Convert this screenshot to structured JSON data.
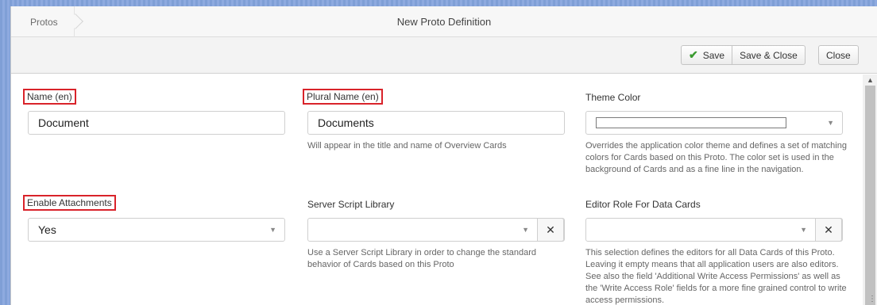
{
  "breadcrumb": {
    "item": "Protos"
  },
  "window": {
    "title": "New Proto Definition"
  },
  "toolbar": {
    "save_label": "Save",
    "save_close_label": "Save & Close",
    "close_label": "Close"
  },
  "icons": {
    "save": "check-icon",
    "dropdown": "caret-down-icon",
    "clear": "times-icon",
    "scroll_up": "caret-up-icon"
  },
  "colors": {
    "save_check": "#3a9a2f",
    "highlight": "#d9232a"
  },
  "fields": {
    "name": {
      "label": "Name (en)",
      "value": "Document"
    },
    "plural_name": {
      "label": "Plural Name (en)",
      "value": "Documents",
      "help": "Will appear in the title and name of Overview Cards"
    },
    "theme_color": {
      "label": "Theme Color",
      "value": "",
      "help": "Overrides the application color theme and defines a set of matching colors for Cards based on this Proto. The color set is used in the background of Cards and as a fine line in the navigation."
    },
    "enable_attachments": {
      "label": "Enable Attachments",
      "value": "Yes"
    },
    "server_script_library": {
      "label": "Server Script Library",
      "value": "",
      "help": "Use a Server Script Library in order to change the standard behavior of Cards based on this Proto"
    },
    "editor_role": {
      "label": "Editor Role For Data Cards",
      "value": "",
      "help": "This selection defines the editors for all Data Cards of this Proto. Leaving it empty means that all application users are also editors. See also the field 'Additional Write Access Permissions' as well as the 'Write Access Role' fields for a more fine grained control to write access permissions."
    }
  }
}
